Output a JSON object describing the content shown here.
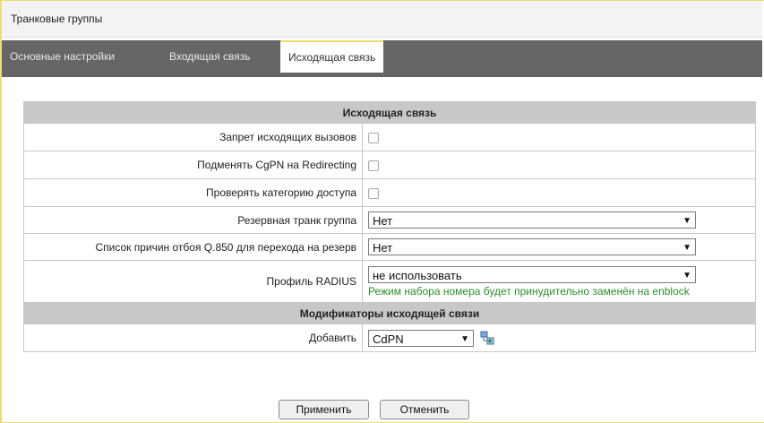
{
  "header": {
    "title": "Транковые группы"
  },
  "tabs": [
    {
      "label": "Основные настройки"
    },
    {
      "label": "Входящая связь"
    },
    {
      "label": "Исходящая связь"
    }
  ],
  "sections": {
    "outgoing": "Исходящая связь",
    "modifiers": "Модификаторы исходящей связи"
  },
  "rows": {
    "block_outgoing": {
      "label": "Запрет исходящих вызовов",
      "checked": false
    },
    "replace_cgpn": {
      "label": "Подменять CgPN на Redirecting",
      "checked": false
    },
    "check_category": {
      "label": "Проверять категорию доступа",
      "checked": false
    },
    "backup_trunk": {
      "label": "Резервная транк группа",
      "value": "Нет"
    },
    "q850_list": {
      "label": "Список причин отбоя Q.850 для перехода на резерв",
      "value": "Нет"
    },
    "radius_profile": {
      "label": "Профиль RADIUS",
      "value": "не использовать",
      "hint": "Режим набора номера будет принудительно заменён на enblock"
    },
    "add": {
      "label": "Добавить",
      "value": "CdPN"
    }
  },
  "buttons": {
    "apply": "Применить",
    "cancel": "Отменить"
  },
  "colors": {
    "accent": "#f0dc6e",
    "tabbar": "#666666",
    "section": "#c8c8c8",
    "hint": "#2e8b2e"
  },
  "icons": {
    "add": "add-modifier-icon",
    "dropdown": "dropdown-arrow-icon",
    "checkbox": "checkbox"
  }
}
